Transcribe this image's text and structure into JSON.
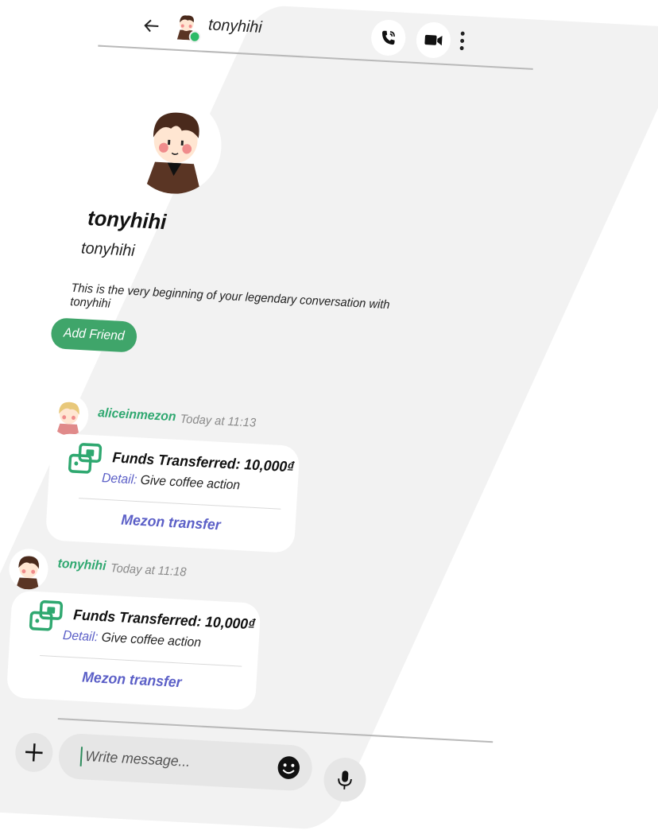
{
  "header": {
    "title": "tonyhihi"
  },
  "profile": {
    "name": "tonyhihi",
    "handle": "tonyhihi",
    "intro": "This is the very beginning of your legendary conversation with tonyhihi",
    "add_friend_label": "Add Friend"
  },
  "messages": [
    {
      "user": "aliceinmezon",
      "time": "Today at 11:13",
      "card": {
        "title": "Funds Transferred: 10,000₫",
        "detail_label": "Detail:",
        "detail_value": "Give coffee action",
        "link": "Mezon transfer"
      }
    },
    {
      "user": "tonyhihi",
      "time": "Today at 11:18",
      "card": {
        "title": "Funds Transferred: 10,000₫",
        "detail_label": "Detail:",
        "detail_value": "Give coffee action",
        "link": "Mezon transfer"
      }
    }
  ],
  "composer": {
    "placeholder": "Write message..."
  },
  "icons": {
    "back": "arrow-left-icon",
    "call": "phone-call-icon",
    "video": "video-camera-icon",
    "more": "more-vertical-icon",
    "plus": "plus-icon",
    "emoji": "emoji-icon",
    "mic": "microphone-icon",
    "transfer": "transfer-icon"
  },
  "colors": {
    "accent_green": "#3fa56a",
    "username_green": "#2fa870",
    "link_purple": "#5b5fc7",
    "online": "#2dba67"
  }
}
